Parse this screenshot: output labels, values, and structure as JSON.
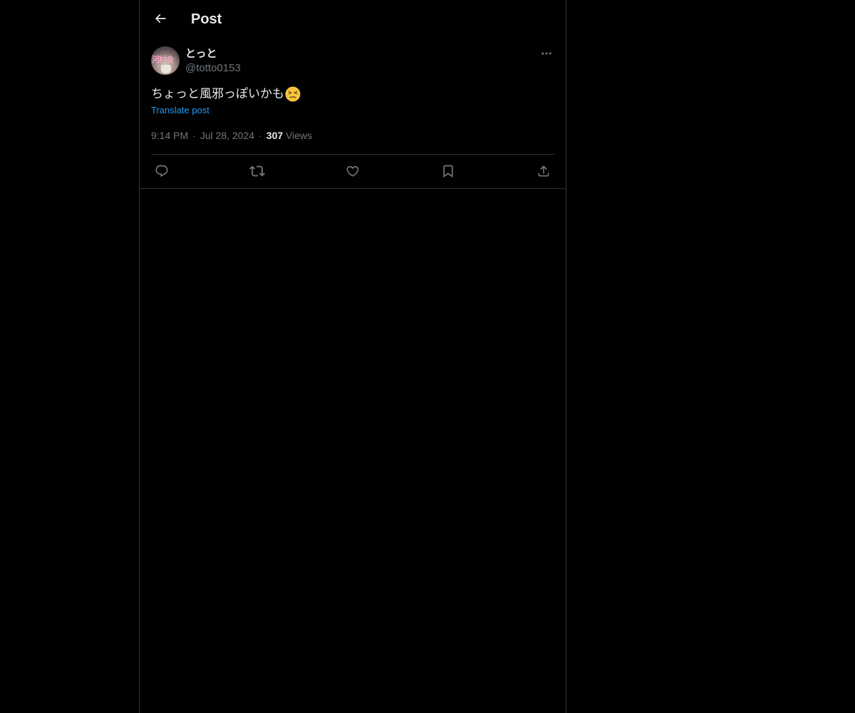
{
  "header": {
    "title": "Post",
    "back_icon": "arrow-left-icon"
  },
  "post": {
    "author": {
      "display_name": "とっと",
      "handle": "@totto0153",
      "avatar_text": "河村会"
    },
    "text": "ちょっと風邪っぽいかも",
    "emoji": "persevering-face-emoji",
    "translate_label": "Translate post",
    "time": "9:14 PM",
    "date": "Jul 28, 2024",
    "views_count": "307",
    "views_label": "Views",
    "separator": "·"
  },
  "actions": [
    {
      "name": "reply",
      "icon": "reply-icon"
    },
    {
      "name": "repost",
      "icon": "repost-icon"
    },
    {
      "name": "like",
      "icon": "heart-icon"
    },
    {
      "name": "bookmark",
      "icon": "bookmark-icon"
    },
    {
      "name": "share",
      "icon": "share-icon"
    }
  ],
  "colors": {
    "background": "#000000",
    "text": "#e7e9ea",
    "secondary": "#71767b",
    "border": "#2f3336",
    "link": "#1d9bf0"
  }
}
